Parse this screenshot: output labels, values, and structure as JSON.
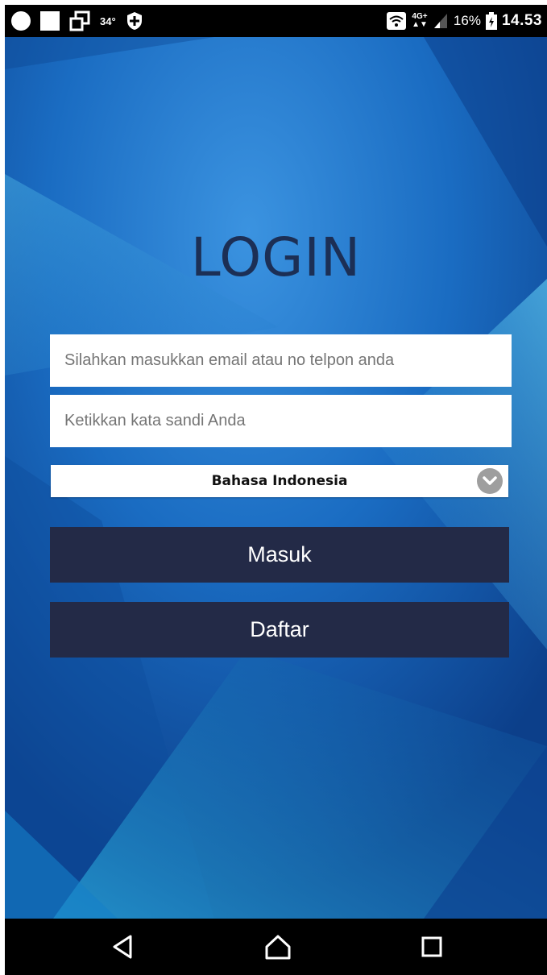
{
  "status_bar": {
    "temperature": "34°",
    "network_type": "4G+",
    "battery": "16%",
    "time": "14.53"
  },
  "login": {
    "title": "LOGIN",
    "email_placeholder": "Silahkan masukkan email atau no telpon anda",
    "password_placeholder": "Ketikkan kata sandi Anda",
    "language_selected": "Bahasa Indonesia",
    "login_button": "Masuk",
    "register_button": "Daftar"
  },
  "colors": {
    "title": "#1c2f55",
    "button_bg": "#232a47",
    "background": "#1a6ec4"
  },
  "icons": {
    "status_left": [
      "circle-notification-icon",
      "square-notification-icon",
      "multi-window-icon",
      "shield-icon"
    ],
    "status_right": [
      "wifi-icon",
      "signal-icon",
      "battery-icon"
    ],
    "dropdown": "chevron-down-icon",
    "nav": [
      "back-icon",
      "home-icon",
      "recent-apps-icon"
    ]
  }
}
